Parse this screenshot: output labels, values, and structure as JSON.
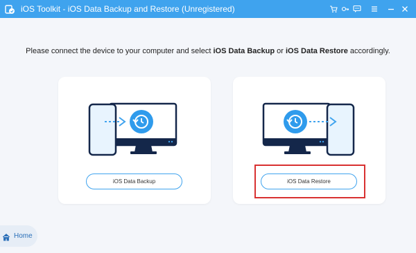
{
  "window": {
    "title": "iOS Toolkit - iOS Data Backup and Restore (Unregistered)",
    "controls": [
      "cart-icon",
      "key-icon",
      "chat-icon",
      "menu-icon",
      "minimize-icon",
      "close-icon"
    ]
  },
  "instruction": {
    "prefix": "Please connect the device to your computer and select ",
    "option1": "iOS Data Backup",
    "middle": " or ",
    "option2": "iOS Data Restore",
    "suffix": " accordingly."
  },
  "cards": {
    "backup": {
      "button_label": "iOS Data Backup"
    },
    "restore": {
      "button_label": "iOS Data Restore"
    }
  },
  "home": {
    "label": "Home"
  },
  "colors": {
    "accent": "#3fa3ee",
    "highlight": "#d83030",
    "navy": "#14274a"
  }
}
